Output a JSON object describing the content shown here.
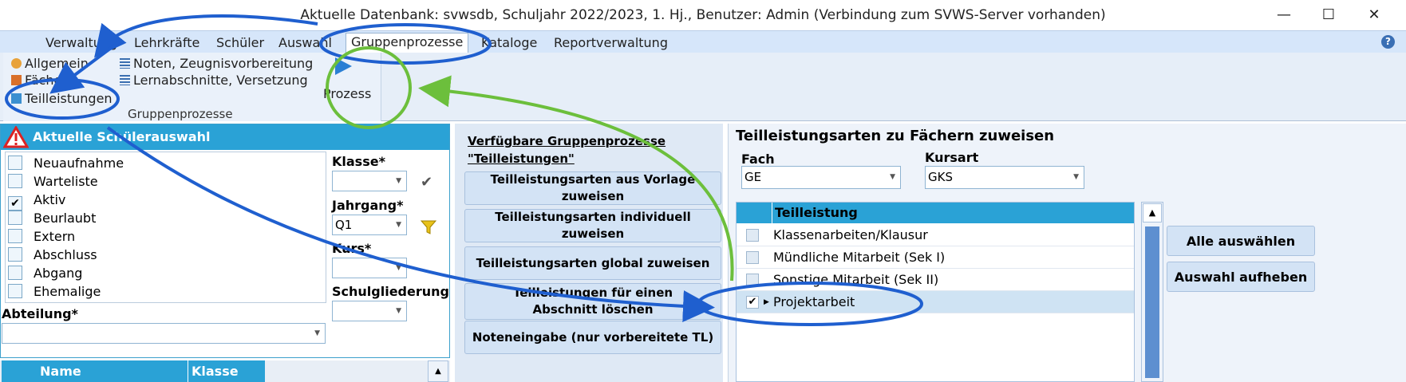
{
  "window": {
    "title": "Aktuelle Datenbank: svwsdb, Schuljahr 2022/2023, 1. Hj., Benutzer: Admin (Verbindung zum SVWS-Server vorhanden)",
    "minimize": "—",
    "maximize": "☐",
    "close": "✕"
  },
  "menu": {
    "items": [
      "Verwaltung",
      "Lehrkräfte",
      "Schüler",
      "Auswahl",
      "Gruppenprozesse",
      "Kataloge",
      "Reportverwaltung"
    ],
    "active": "Gruppenprozesse",
    "help": "?"
  },
  "ribbon": {
    "col1": [
      "Allgemein",
      "Fächer",
      "Teilleistungen"
    ],
    "col2": [
      "Noten, Zeugnisvorbereitung",
      "Lernabschnitte, Versetzung"
    ],
    "group_label": "Gruppenprozesse",
    "prozess": "Prozess"
  },
  "left": {
    "header": "Aktuelle Schülerauswahl",
    "status": [
      {
        "label": "Neuaufnahme",
        "checked": false
      },
      {
        "label": "Warteliste",
        "checked": false
      },
      {
        "label": "Aktiv",
        "checked": true
      },
      {
        "label": "Beurlaubt",
        "checked": false
      },
      {
        "label": "Extern",
        "checked": false
      },
      {
        "label": "Abschluss",
        "checked": false
      },
      {
        "label": "Abgang",
        "checked": false
      },
      {
        "label": "Ehemalige",
        "checked": false
      }
    ],
    "check_mark": "✔",
    "klasse_label": "Klasse*",
    "klasse_value": "",
    "jahrgang_label": "Jahrgang*",
    "jahrgang_value": "Q1",
    "kurs_label": "Kurs*",
    "kurs_value": "",
    "schulgliederung_label": "Schulgliederung*",
    "schulgliederung_value": "",
    "abteilung_label": "Abteilung*",
    "abteilung_value": "",
    "grid_columns": [
      "Name",
      "Klasse"
    ]
  },
  "middle": {
    "title_line1": "Verfügbare Gruppenprozesse",
    "title_line2": "\"Teilleistungen\"",
    "buttons": [
      "Teilleistungsarten aus Vorlage zuweisen",
      "Teilleistungsarten individuell zuweisen",
      "Teilleistungsarten global zuweisen",
      "Teilleistungen für einen Abschnitt löschen",
      "Noteneingabe (nur vorbereitete TL)"
    ]
  },
  "right": {
    "title": "Teilleistungsarten zu Fächern zuweisen",
    "fach_label": "Fach",
    "fach_value": "GE",
    "kursart_label": "Kursart",
    "kursart_value": "GKS",
    "grid_header": "Teilleistung",
    "rows": [
      {
        "label": "Klassenarbeiten/Klausur",
        "checked": false
      },
      {
        "label": "Mündliche Mitarbeit (Sek I)",
        "checked": false
      },
      {
        "label": "Sonstige Mitarbeit (Sek II)",
        "checked": false
      },
      {
        "label": "Projektarbeit",
        "checked": true
      }
    ],
    "select_all": "Alle auswählen",
    "deselect": "Auswahl aufheben"
  },
  "colors": {
    "header_blue": "#2aa2d6",
    "annotation_blue": "#1f5fcf",
    "annotation_green": "#6cbf3c"
  }
}
